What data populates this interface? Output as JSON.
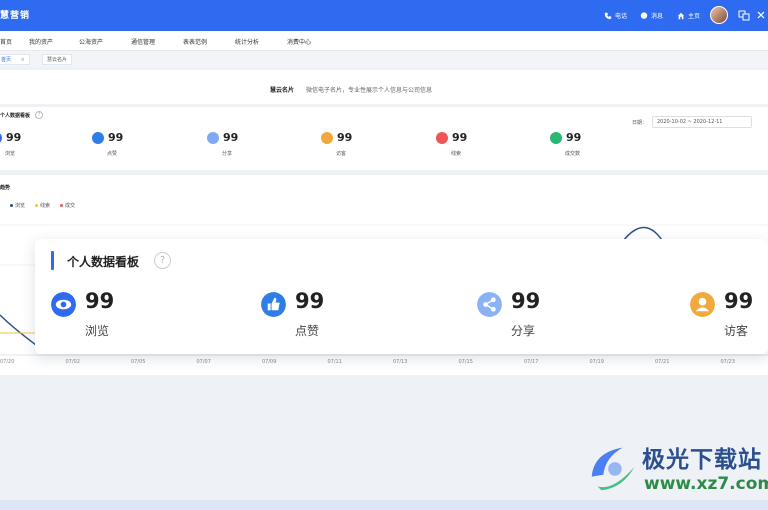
{
  "topbar": {
    "brand": "慧营销",
    "items": [
      {
        "label": "电话"
      },
      {
        "label": "消息"
      },
      {
        "label": "主页"
      }
    ]
  },
  "menu": {
    "items": [
      "首页",
      "我的资产",
      "公海资产",
      "通信管理",
      "表表范例",
      "统计分析",
      "消费中心"
    ]
  },
  "tabs": [
    {
      "label": "首页",
      "close": "×"
    },
    {
      "label": "慧云名片"
    }
  ],
  "banner": {
    "title": "慧云名片",
    "desc": "微信电子名片，专业性展示个人信息与公司信息"
  },
  "small_panel": {
    "title": "个人数据看板",
    "help": "?",
    "date_label": "日期：",
    "date_range": "2020-10-02 ~ 2020-12-11",
    "stats": [
      {
        "value": "99",
        "label": "浏览",
        "color": "#2f6bf0"
      },
      {
        "value": "99",
        "label": "点赞",
        "color": "#2f7ee8"
      },
      {
        "value": "99",
        "label": "分享",
        "color": "#7fa9f2"
      },
      {
        "value": "99",
        "label": "访客",
        "color": "#f0a93a"
      },
      {
        "value": "99",
        "label": "线索",
        "color": "#ee5555"
      },
      {
        "value": "99",
        "label": "成交数",
        "color": "#2bb673"
      }
    ]
  },
  "chart_panel": {
    "title": "趋势",
    "legend": [
      {
        "label": "浏览",
        "color": "#2f4f8f"
      },
      {
        "label": "线索",
        "color": "#f0c33a"
      },
      {
        "label": "成交",
        "color": "#ee5555"
      }
    ],
    "x_ticks": [
      "07/20",
      "07/02",
      "07/05",
      "07/07",
      "07/09",
      "07/11",
      "07/13",
      "07/15",
      "07/17",
      "07/19",
      "07/21",
      "07/23"
    ]
  },
  "big_card": {
    "title": "个人数据看板",
    "help": "?",
    "stats": [
      {
        "value": "99",
        "label": "浏览",
        "color": "#2f6bf0",
        "icon": "eye-icon"
      },
      {
        "value": "99",
        "label": "点赞",
        "color": "#2f7ee8",
        "icon": "thumbs-up-icon"
      },
      {
        "value": "99",
        "label": "分享",
        "color": "#8ab2f5",
        "icon": "share-icon"
      },
      {
        "value": "99",
        "label": "访客",
        "color": "#f0a93a",
        "icon": "user-icon"
      }
    ]
  },
  "watermark": {
    "name": "极光下载站",
    "url": "www.xz7.com"
  }
}
